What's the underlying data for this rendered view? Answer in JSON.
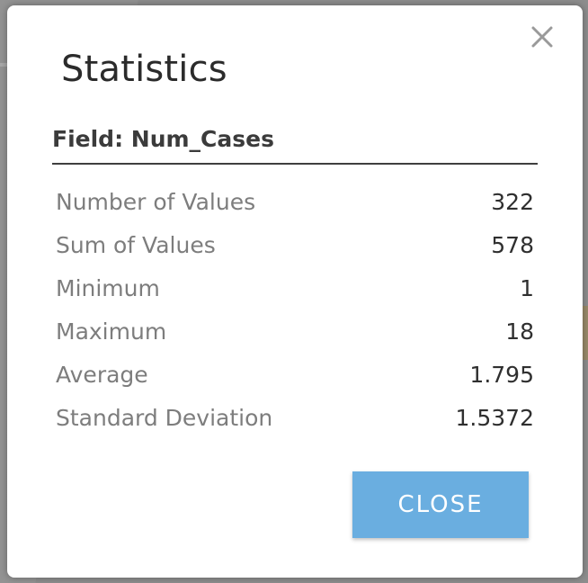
{
  "dialog": {
    "title": "Statistics",
    "field_label": "Field: Num_Cases",
    "stats": [
      {
        "label": "Number of Values",
        "value": "322"
      },
      {
        "label": "Sum of Values",
        "value": "578"
      },
      {
        "label": "Minimum",
        "value": "1"
      },
      {
        "label": "Maximum",
        "value": "18"
      },
      {
        "label": "Average",
        "value": "1.795"
      },
      {
        "label": "Standard Deviation",
        "value": "1.5372"
      }
    ],
    "close_button_label": "CLOSE",
    "close_icon": "close-icon"
  },
  "colors": {
    "close_button": "#6aaee0",
    "title_text": "#2b2b2b",
    "stat_label": "#7d7d7d",
    "stat_value": "#2f2f2f"
  }
}
